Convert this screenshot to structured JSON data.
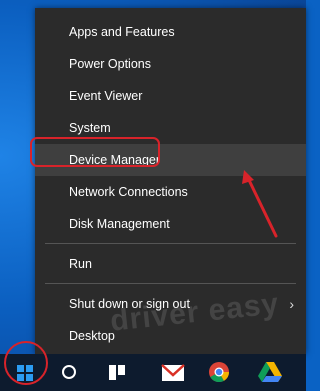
{
  "menu": {
    "items": [
      {
        "label": "Apps and Features"
      },
      {
        "label": "Power Options"
      },
      {
        "label": "Event Viewer"
      },
      {
        "label": "System"
      },
      {
        "label": "Device Manager"
      },
      {
        "label": "Network Connections"
      },
      {
        "label": "Disk Management"
      },
      {
        "label": "Run"
      },
      {
        "label": "Shut down or sign out"
      },
      {
        "label": "Desktop"
      }
    ]
  },
  "watermark": "driver easy",
  "colors": {
    "menu_bg": "#2b2b2b",
    "highlight": "#3f3f3f",
    "annotation": "#d8232a",
    "taskbar": "#0d1b2e"
  },
  "icons": [
    "windows-start-icon",
    "cortana-search-icon",
    "task-view-icon",
    "gmail-icon",
    "chrome-icon",
    "google-drive-icon",
    "chevron-right-icon",
    "arrow-annotation"
  ]
}
